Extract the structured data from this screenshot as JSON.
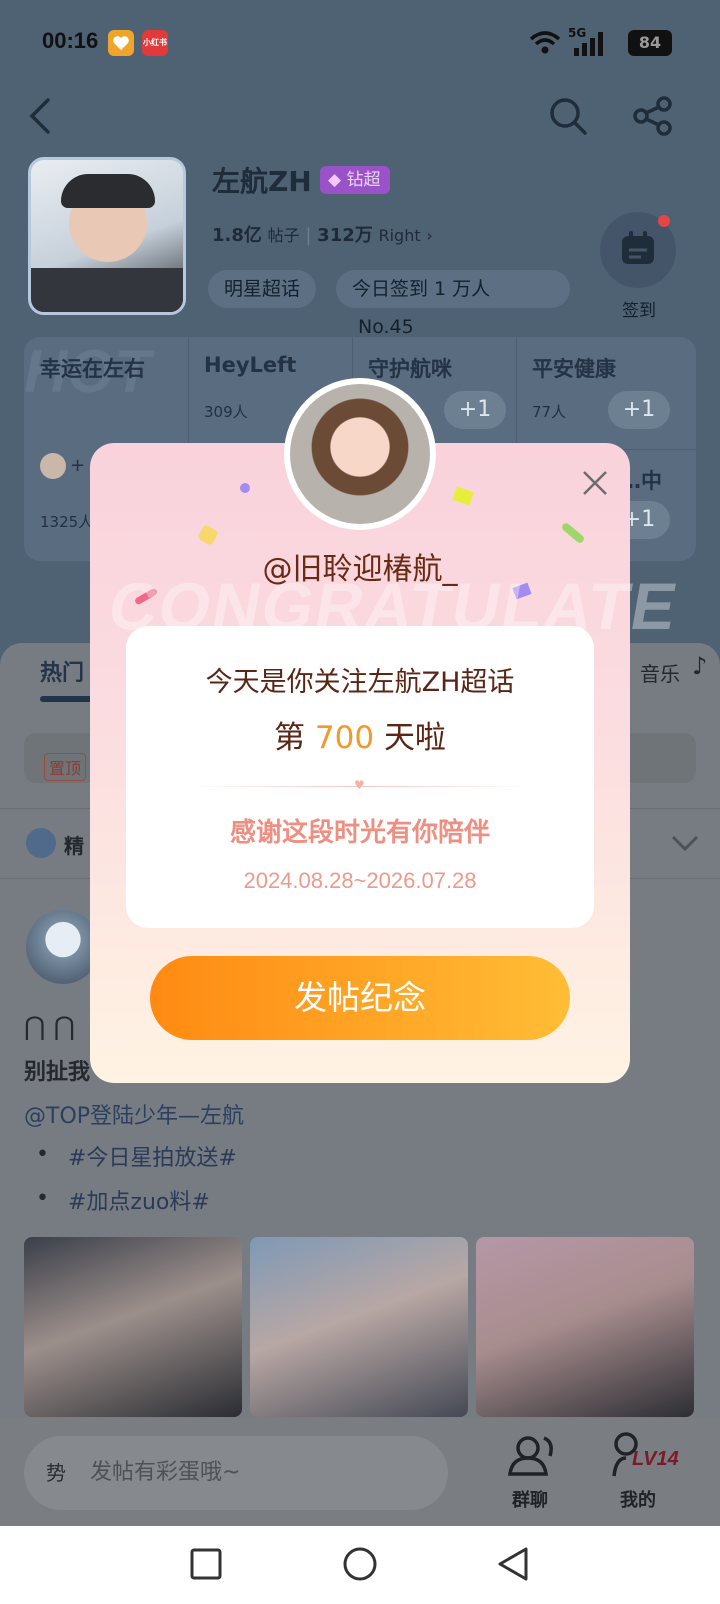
{
  "status_bar": {
    "time": "00:16",
    "network": "5G",
    "battery": "84",
    "app_icon_1": "heart-app-icon",
    "app_icon_2": "xiaohongshu-icon",
    "app_icon_2_text": "小红书"
  },
  "header": {
    "title": "左航ZH",
    "badge": "钻超",
    "posts_count": "1.8亿",
    "posts_label": "帖子",
    "fans_count": "312万",
    "fans_label": "Right",
    "tag_chip": "明星超话",
    "checkin_chip": "今日签到 1 万人",
    "rank": "No.45",
    "checkin_label": "签到"
  },
  "groups": [
    {
      "name": "幸运在左右",
      "count": "1325人",
      "watermark": "HOT"
    },
    {
      "name": "HeyLeft",
      "count": "309人"
    },
    {
      "name": "守护航咪",
      "count": ""
    },
    {
      "name": "平安健康",
      "count": "77人"
    },
    {
      "name": "…中",
      "count": ""
    }
  ],
  "tabs": {
    "hot": "热门",
    "music": "音乐"
  },
  "pinned_tag": "置顶",
  "featured_label": "精",
  "post": {
    "title_partial": "别扯我",
    "mention": "@TOP登陆少年—左航",
    "hashtags": [
      "#今日星拍放送#",
      "#加点zuo料#"
    ]
  },
  "bottom_bar": {
    "input_placeholder": "发帖有彩蛋哦~",
    "input_prefix": "势",
    "group_chat": "群聊",
    "mine": "我的",
    "level": "LV14"
  },
  "modal": {
    "nickname": "@旧聆迎椿航_",
    "background_word": "CONGRATULATE",
    "line1": "今天是你关注左航ZH超话",
    "line2_prefix": "第",
    "days": "700",
    "line2_suffix": "天啦",
    "thanks": "感谢这段时光有你陪伴",
    "date_range": "2024.08.28~2026.07.28",
    "cta": "发帖纪念"
  },
  "colors": {
    "accent_orange": "#ff8a12",
    "accent_pink": "#ee8f82",
    "badge_purple": "#9a52c8"
  }
}
